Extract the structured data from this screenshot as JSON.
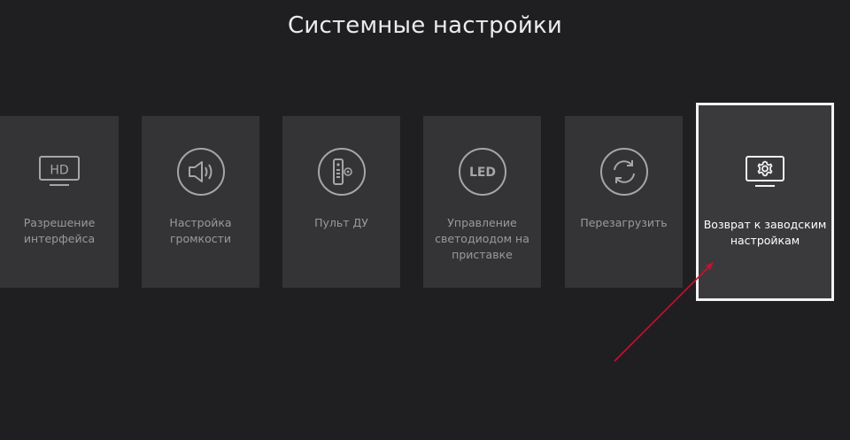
{
  "header": {
    "title": "Системные настройки"
  },
  "tiles": [
    {
      "label": "Разрешение интерфейса",
      "icon": "hd-display-icon",
      "selected": false
    },
    {
      "label": "Настройка громкости",
      "icon": "speaker-volume-icon",
      "selected": false
    },
    {
      "label": "Пульт ДУ",
      "icon": "remote-control-icon",
      "selected": false
    },
    {
      "label": "Управление светодиодом на приставке",
      "icon": "led-icon",
      "selected": false
    },
    {
      "label": "Перезагрузить",
      "icon": "refresh-icon",
      "selected": false
    },
    {
      "label": "Возврат к заводским настройкам",
      "icon": "factory-reset-gear-icon",
      "selected": true
    }
  ],
  "icon_text": {
    "hd": "HD",
    "led": "LED"
  },
  "colors": {
    "background": "#1f1f21",
    "tile": "#343436",
    "selected_border": "#f2f2f2",
    "annotation_arrow": "#c8102e"
  }
}
